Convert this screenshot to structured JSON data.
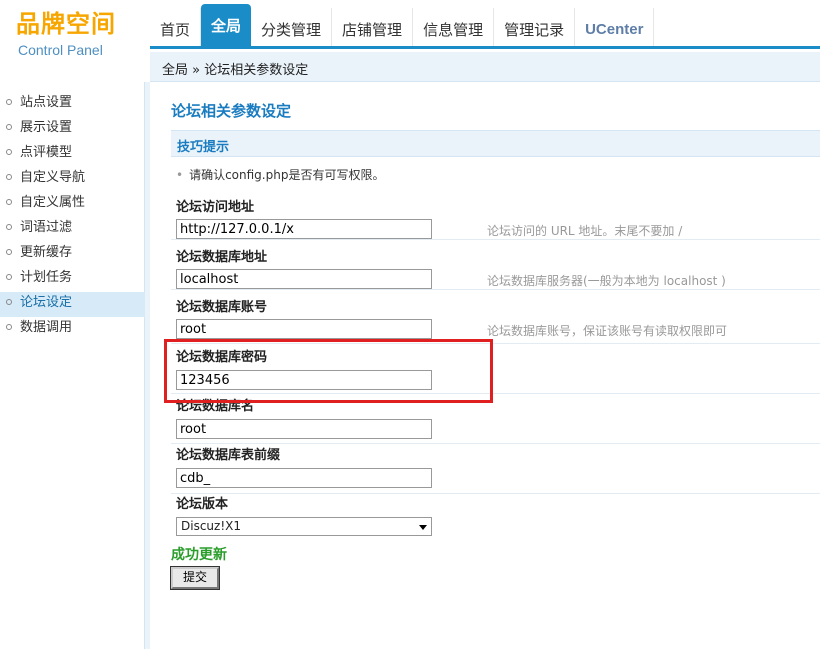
{
  "logo": {
    "title": "品牌空间",
    "subtitle": "Control Panel"
  },
  "nav": {
    "tabs": [
      {
        "label": "首页"
      },
      {
        "label": "全局"
      },
      {
        "label": "分类管理"
      },
      {
        "label": "店铺管理"
      },
      {
        "label": "信息管理"
      },
      {
        "label": "管理记录"
      },
      {
        "label": "UCenter"
      }
    ],
    "active_tab": "全局"
  },
  "breadcrumb": "全局 » 论坛相关参数设定",
  "sidebar": {
    "items": [
      {
        "label": "站点设置"
      },
      {
        "label": "展示设置"
      },
      {
        "label": "点评模型"
      },
      {
        "label": "自定义导航"
      },
      {
        "label": "自定义属性"
      },
      {
        "label": "词语过滤"
      },
      {
        "label": "更新缓存"
      },
      {
        "label": "计划任务"
      },
      {
        "label": "论坛设定"
      },
      {
        "label": "数据调用"
      }
    ],
    "active_item": "论坛设定"
  },
  "main": {
    "title": "论坛相关参数设定",
    "tip_header": "技巧提示",
    "tip": "请确认config.php是否有可写权限。",
    "fields": [
      {
        "label": "论坛访问地址",
        "value": "http://127.0.0.1/x",
        "hint": "论坛访问的 URL 地址。末尾不要加 /"
      },
      {
        "label": "论坛数据库地址",
        "value": "localhost",
        "hint": "论坛数据库服务器(一般为本地为 localhost )"
      },
      {
        "label": "论坛数据库账号",
        "value": "root",
        "hint": "论坛数据库账号，保证该账号有读取权限即可"
      },
      {
        "label": "论坛数据库密码",
        "value": "123456",
        "hint": ""
      },
      {
        "label": "论坛数据库名",
        "value": "root",
        "hint": ""
      },
      {
        "label": "论坛数据库表前缀",
        "value": "cdb_",
        "hint": ""
      }
    ],
    "version": {
      "label": "论坛版本",
      "selected": "Discuz!X1"
    },
    "success_message": "成功更新",
    "submit_label": "提交"
  },
  "colors": {
    "accent": "#1a8cc8",
    "logo": "#f7a600",
    "success": "#2a9d2a",
    "highlight": "#e02020"
  }
}
